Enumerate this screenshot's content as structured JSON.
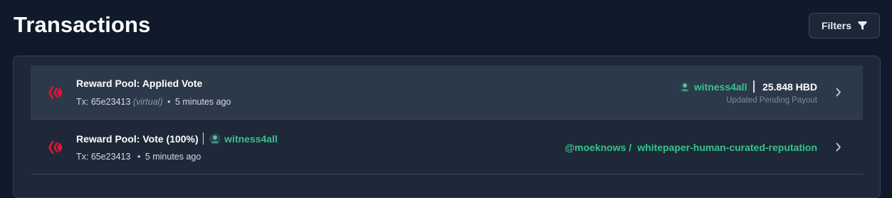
{
  "page": {
    "title": "Transactions"
  },
  "toolbar": {
    "filters_label": "Filters",
    "filters_icon": "funnel-icon"
  },
  "colors": {
    "background": "#111a2b",
    "panel": "#1e2838",
    "row_hover": "#2c394b",
    "accent_green": "#35c48a",
    "hive_red": "#e31337"
  },
  "transactions": [
    {
      "icon": "hive-logo-icon",
      "title": "Reward Pool: Applied Vote",
      "tx_label": "Tx: 65e23413",
      "virtual_label": "(virtual)",
      "time": "5 minutes ago",
      "account": "witness4all",
      "amount": "25.848 HBD",
      "sub_label": "Updated Pending Payout",
      "highlighted": true
    },
    {
      "icon": "hive-logo-icon",
      "title": "Reward Pool: Vote (100%)",
      "account": "witness4all",
      "tx_label": "Tx: 65e23413",
      "time": "5 minutes ago",
      "author": "@moeknows /",
      "permlink": "whitepaper-human-curated-reputation",
      "highlighted": false
    }
  ]
}
